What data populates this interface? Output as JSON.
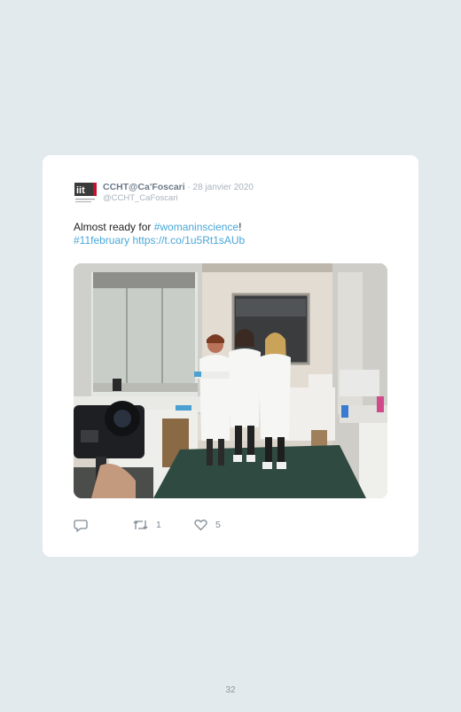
{
  "tweet": {
    "author": {
      "display_name": "CCHT@Ca'Foscari",
      "handle": "@CCHT_CaFoscari",
      "avatar_icon": "iit-logo-icon",
      "avatar_logo_text": "iit"
    },
    "date_text": " · 28 janvier 2020",
    "text": {
      "prefix": "Almost ready for ",
      "hashtag1": "#womaninscience",
      "suffix1": "!",
      "hashtag2": "#11february",
      "link": "https://t.co/1u5Rt1sAUb"
    },
    "media": {
      "icon": "lab-photo-image"
    },
    "actions": {
      "reply_icon": "reply-icon",
      "retweet_icon": "retweet-icon",
      "retweet_count": "1",
      "like_icon": "heart-icon",
      "like_count": "5"
    }
  },
  "page_number": "32",
  "colors": {
    "background": "#e3eaee",
    "card": "#ffffff",
    "link": "#4aa7d8",
    "muted": "#a9b3bd",
    "logo_red": "#c8102e"
  }
}
